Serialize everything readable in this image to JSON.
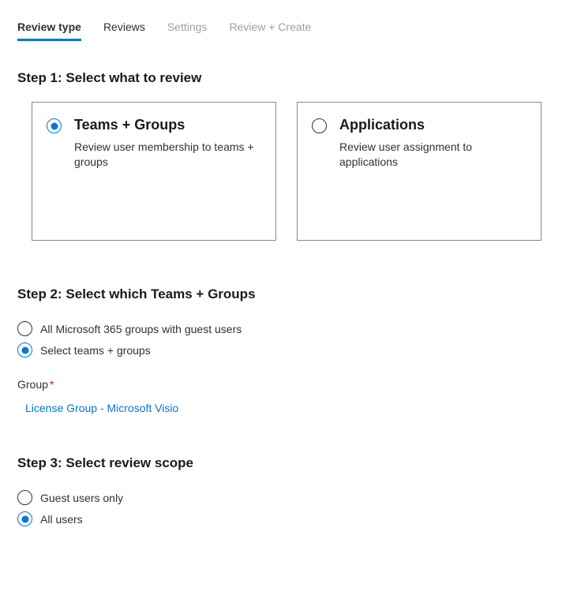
{
  "tabs": {
    "review_type": "Review type",
    "reviews": "Reviews",
    "settings": "Settings",
    "review_create": "Review + Create"
  },
  "step1": {
    "title": "Step 1: Select what to review",
    "teams_groups": {
      "title": "Teams + Groups",
      "desc": "Review user membership to teams + groups"
    },
    "applications": {
      "title": "Applications",
      "desc": "Review user assignment to applications"
    }
  },
  "step2": {
    "title": "Step 2: Select which Teams + Groups",
    "option_all": "All Microsoft 365 groups with guest users",
    "option_select": "Select teams + groups",
    "group_label": "Group",
    "group_value": "License Group - Microsoft Visio"
  },
  "step3": {
    "title": "Step 3: Select review scope",
    "option_guest": "Guest users only",
    "option_all": "All users"
  }
}
